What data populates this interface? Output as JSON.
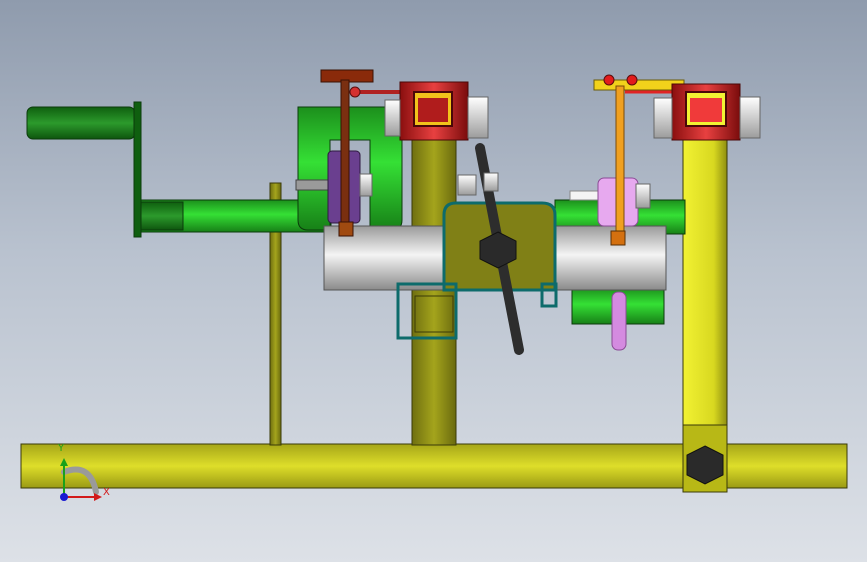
{
  "viewport": {
    "background_top": "#8f9bad",
    "background_bottom": "#dde1e7"
  },
  "triad": {
    "x_label": "X",
    "y_label": "Y",
    "x_color": "#d21a1a",
    "y_color": "#1aa11a",
    "z_color": "#1a1ad2"
  },
  "parts": [
    {
      "name": "base-beam",
      "color": "#d6d61e"
    },
    {
      "name": "crank-handle",
      "color": "#1e8a1e"
    },
    {
      "name": "horizontal-pipe",
      "color": "#27d427"
    },
    {
      "name": "steel-cylinder",
      "color": "#c8c8c8"
    },
    {
      "name": "clamp-blocks",
      "color": "#e23030"
    },
    {
      "name": "lever-arm",
      "color": "#2a2a2a"
    },
    {
      "name": "bracket",
      "color": "#0d6b6b"
    },
    {
      "name": "column-posts",
      "color": "#8a8a12"
    },
    {
      "name": "flange-disc",
      "color": "#d48be0"
    },
    {
      "name": "link-rod",
      "color": "#f0a020"
    }
  ]
}
